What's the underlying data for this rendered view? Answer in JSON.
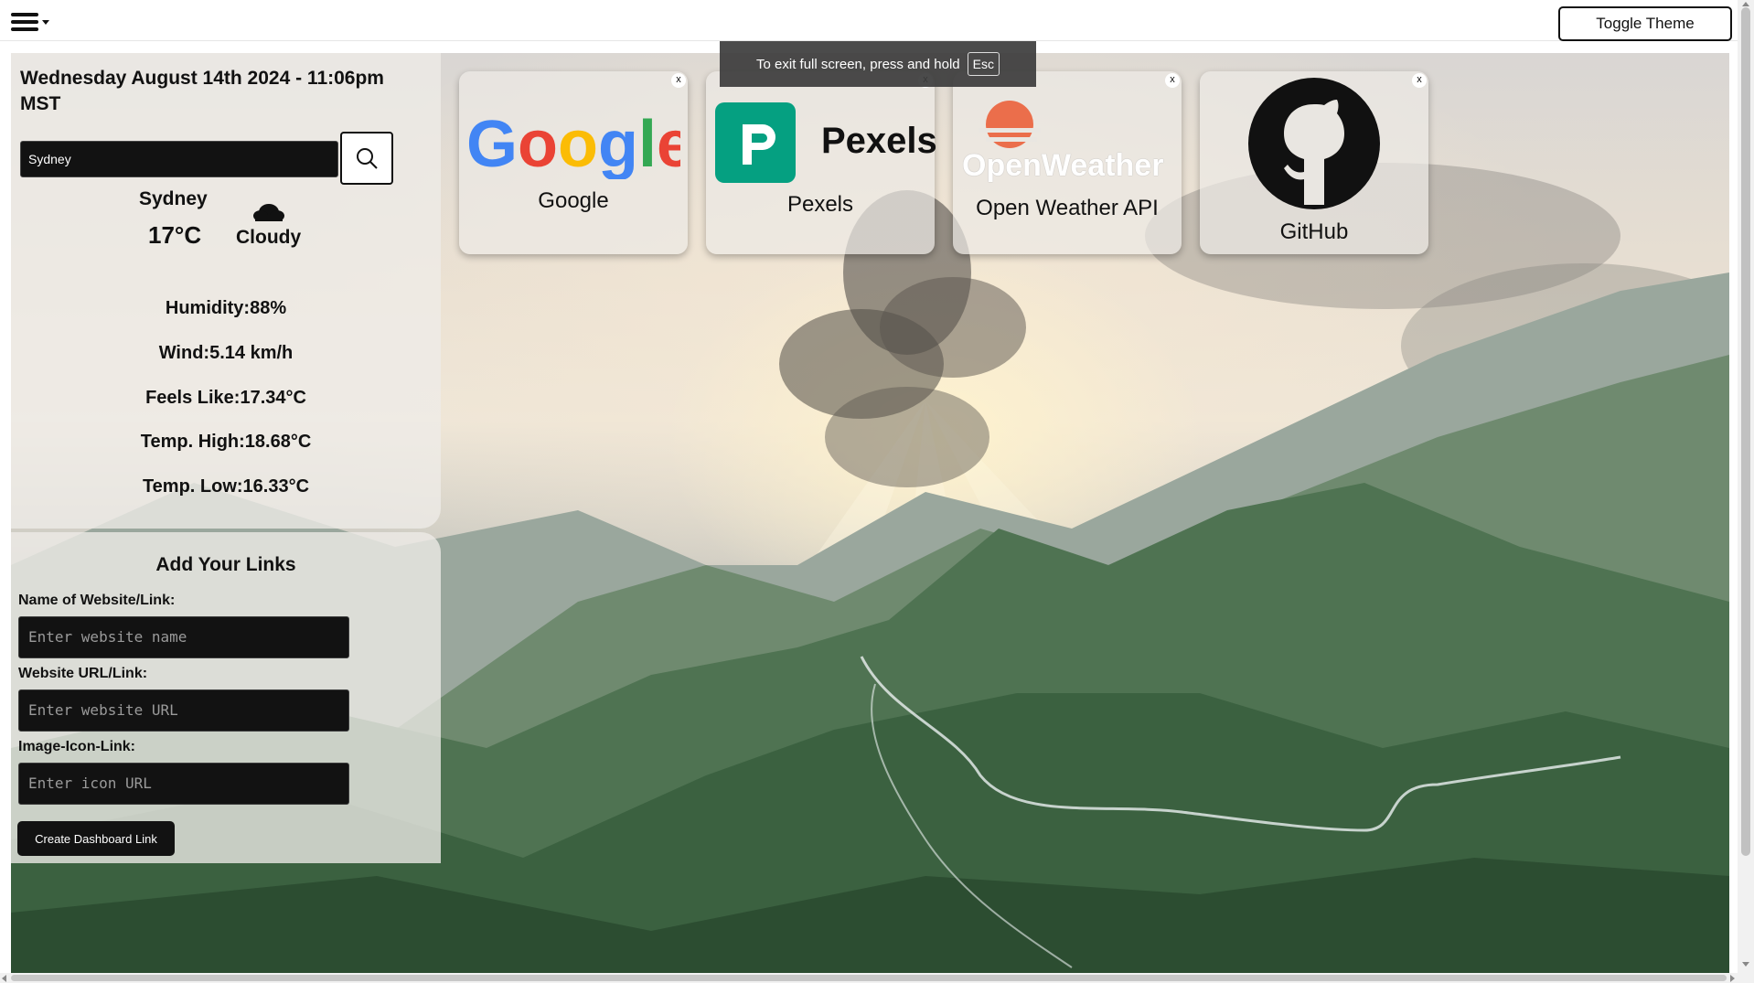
{
  "topbar": {
    "menu_icon": "hamburger-menu-icon",
    "toggle_theme_label": "Toggle Theme"
  },
  "fullscreen_notice": {
    "text": "To exit full screen, press and hold",
    "key": "Esc"
  },
  "weather": {
    "datetime": "Wednesday August 14th 2024 - 11:06pm MST",
    "search_value": "Sydney",
    "search_icon": "magnifier-icon",
    "city": "Sydney",
    "temperature": "17°C",
    "condition_icon": "cloud-icon",
    "condition": "Cloudy",
    "stats": [
      "Humidity:88%",
      "Wind:5.14 km/h",
      "Feels Like:17.34°C",
      "Temp. High:18.68°C",
      "Temp. Low:16.33°C"
    ]
  },
  "links_form": {
    "title": "Add Your Links",
    "name_label": "Name of Website/Link:",
    "name_placeholder": "Enter website name",
    "url_label": "Website URL/Link:",
    "url_placeholder": "Enter website URL",
    "icon_label": "Image-Icon-Link:",
    "icon_placeholder": "Enter icon URL",
    "submit_label": "Create Dashboard Link"
  },
  "cards": [
    {
      "label": "Google",
      "icon": "google-logo",
      "close": "x"
    },
    {
      "label": "Pexels",
      "icon": "pexels-logo",
      "logo_text": "Pexels",
      "close": "x"
    },
    {
      "label": "Open Weather API",
      "icon": "openweather-logo",
      "logo_text": "OpenWeather",
      "close": "x"
    },
    {
      "label": "GitHub",
      "icon": "github-logo",
      "close": "x"
    }
  ],
  "colors": {
    "panel_bg": "#eeece8",
    "input_bg": "#121212",
    "pexels_green": "#05a081",
    "openweather_orange": "#eb6e4b"
  }
}
